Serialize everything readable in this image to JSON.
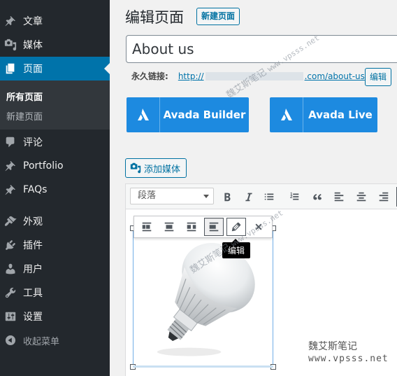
{
  "sidebar": {
    "items": [
      {
        "label": "文章",
        "icon": "pin-icon"
      },
      {
        "label": "媒体",
        "icon": "media-icon"
      },
      {
        "label": "页面",
        "icon": "pages-icon",
        "active": true
      },
      {
        "label": "评论",
        "icon": "comment-icon"
      },
      {
        "label": "Portfolio",
        "icon": "pin-icon"
      },
      {
        "label": "FAQs",
        "icon": "pin-icon"
      },
      {
        "label": "外观",
        "icon": "appearance-icon"
      },
      {
        "label": "插件",
        "icon": "plugins-icon"
      },
      {
        "label": "用户",
        "icon": "users-icon"
      },
      {
        "label": "工具",
        "icon": "tools-icon"
      },
      {
        "label": "设置",
        "icon": "settings-icon"
      },
      {
        "label": "收起菜单",
        "icon": "collapse-icon"
      }
    ],
    "submenu": [
      {
        "label": "所有页面",
        "current": true
      },
      {
        "label": "新建页面"
      }
    ]
  },
  "header": {
    "title": "编辑页面",
    "add_new_label": "新建页面"
  },
  "post": {
    "title_value": "About us",
    "permalink_label": "永久链接:",
    "permalink_prefix": "http://",
    "permalink_suffix": ".com/about-us",
    "edit_slug_label": "编辑"
  },
  "builders": {
    "avada_builder": "Avada Builder",
    "avada_live": "Avada Live"
  },
  "editor": {
    "add_media_label": "添加媒体",
    "format_value": "段落",
    "tooltip": "编辑"
  },
  "watermark": {
    "diag1_cn": "魏艾斯笔记",
    "diag1_en": "www.vpsss.net",
    "diag2_cn": "魏艾斯笔记",
    "diag2_en": "www.vpsss.net",
    "corner_cn": "魏艾斯笔记",
    "corner_en": "www.vpsss.net"
  },
  "colors": {
    "sidebar_bg": "#23282d",
    "active": "#0073aa",
    "avada_blue": "#1d8ae0",
    "link": "#0071a1"
  }
}
